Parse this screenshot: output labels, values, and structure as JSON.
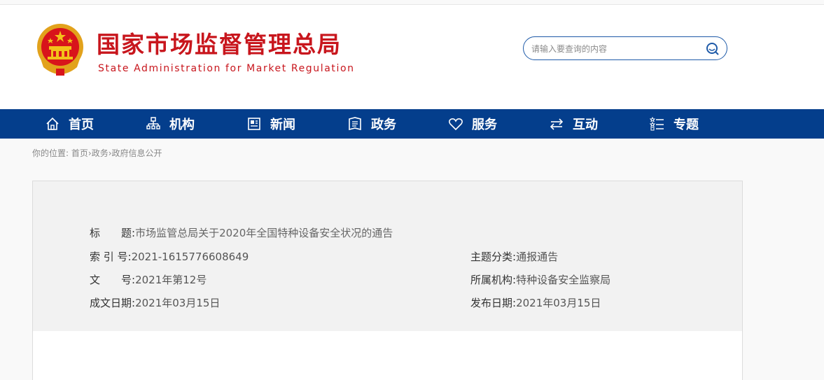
{
  "header": {
    "title": "国家市场监督管理总局",
    "subtitle": "State Administration for Market Regulation",
    "search_placeholder": "请输入要查询的内容"
  },
  "nav": {
    "items": [
      {
        "label": "首页",
        "icon": "home-icon"
      },
      {
        "label": "机构",
        "icon": "org-chart-icon"
      },
      {
        "label": "新闻",
        "icon": "news-icon"
      },
      {
        "label": "政务",
        "icon": "government-icon"
      },
      {
        "label": "服务",
        "icon": "heart-icon"
      },
      {
        "label": "互动",
        "icon": "exchange-icon"
      },
      {
        "label": "专题",
        "icon": "topic-list-icon"
      }
    ]
  },
  "breadcrumb": {
    "prefix": "你的位置:",
    "items": [
      "首页",
      "政务",
      "政府信息公开"
    ],
    "separator": "›"
  },
  "meta": {
    "title_label": "标　　题:",
    "title_value": "市场监管总局关于2020年全国特种设备安全状况的通告",
    "index_label": "索 引 号:",
    "index_value": "2021-1615776608649",
    "category_label": "主题分类:",
    "category_value": "通报通告",
    "docno_label": "文　　号:",
    "docno_value": "2021年第12号",
    "agency_label": "所属机构:",
    "agency_value": "特种设备安全监察局",
    "created_label": "成文日期:",
    "created_value": "2021年03月15日",
    "published_label": "发布日期:",
    "published_value": "2021年03月15日"
  },
  "colors": {
    "brand_red": "#c8161d",
    "nav_blue": "#043e8c",
    "search_border": "#1e5aa8"
  }
}
